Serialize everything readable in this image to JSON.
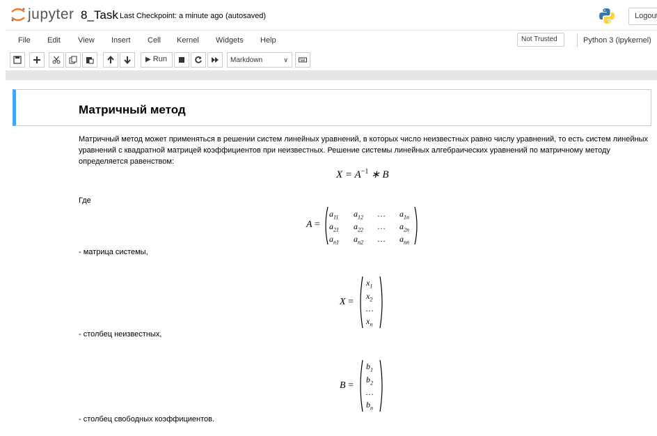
{
  "header": {
    "logo_text": "jupyter",
    "notebook_name": "8_Task",
    "checkpoint": "Last Checkpoint: a minute ago",
    "autosave_status": "(autosaved)",
    "logout_label": "Logout"
  },
  "menubar": {
    "items": [
      "File",
      "Edit",
      "View",
      "Insert",
      "Cell",
      "Kernel",
      "Widgets",
      "Help"
    ],
    "trust_status": "Not Trusted",
    "kernel": "Python 3 (ipykernel)"
  },
  "toolbar": {
    "run_label": "Run",
    "cell_type": "Markdown"
  },
  "notebook": {
    "heading": "Матричный метод",
    "intro": "Матричный метод может применяться в решении систем линейных уравнений, в которых число неизвестных равно числу уравнений, то есть систем линейных уравнений с квадратной матрицей коэффициентов при неизвестных. Решение системы линейных алгебраических уравнений по матричному методу определяется равенством:",
    "equation_main": "X = A",
    "equation_sup": "−1",
    "equation_tail": " ∗ B",
    "where_label": "Где",
    "matrix_a_label": "A",
    "matrix_a_rows": [
      [
        "a",
        "11",
        "a",
        "12",
        "…",
        "",
        "a",
        "1n"
      ],
      [
        "a",
        "21",
        "a",
        "22",
        "…",
        "",
        "a",
        "2n"
      ],
      [
        "a",
        "n1",
        "a",
        "n2",
        "…",
        "",
        "a",
        "nn"
      ]
    ],
    "matrix_a_desc": "- матрица системы,",
    "matrix_x_label": "X",
    "matrix_x_rows": [
      [
        "x",
        "1"
      ],
      [
        "x",
        "2"
      ],
      [
        "…",
        ""
      ],
      [
        "x",
        "n"
      ]
    ],
    "matrix_x_desc": "- столбец неизвестных,",
    "matrix_b_label": "B",
    "matrix_b_rows": [
      [
        "b",
        "1"
      ],
      [
        "b",
        "2"
      ],
      [
        "…",
        ""
      ],
      [
        "b",
        "n"
      ]
    ],
    "matrix_b_desc": "- столбец свободных коэффициентов."
  }
}
